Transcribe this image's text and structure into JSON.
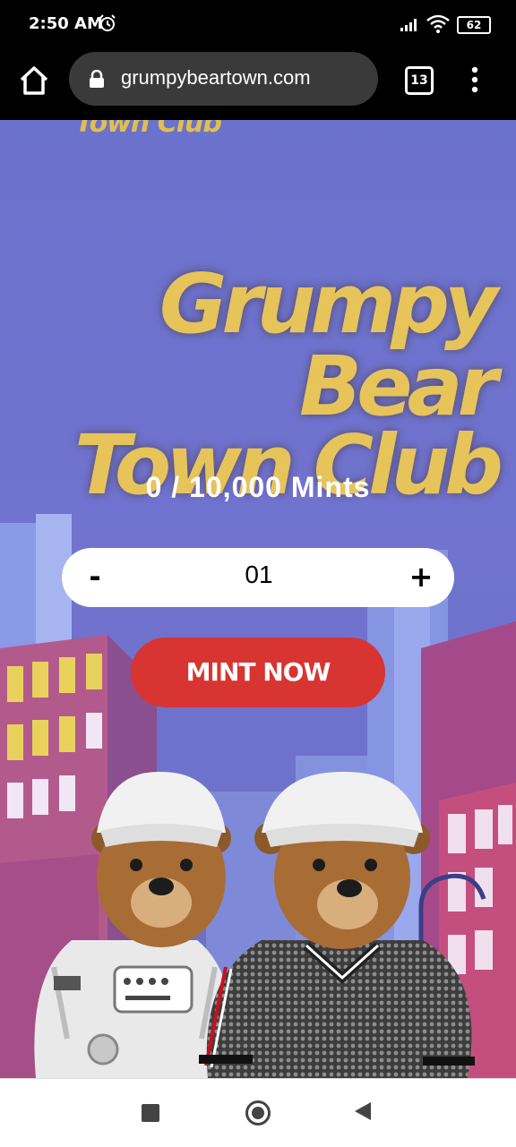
{
  "status_bar": {
    "time": "2:50 AM",
    "battery": "62"
  },
  "browser": {
    "url": "grumpybeartown.com",
    "tab_count": "13"
  },
  "page": {
    "top_logo_fragment": "Town Club",
    "logo_line1": "Grumpy Bear",
    "logo_line2": "Town Club",
    "mint_count": "0 / 10,000 Mints",
    "stepper": {
      "minus": "-",
      "quantity": "01",
      "plus": "+"
    },
    "mint_button": "MINT NOW"
  },
  "colors": {
    "background": "#6b72cc",
    "logo_gold": "#e6c45a",
    "mint_button": "#d83431"
  },
  "icons": [
    "home-icon",
    "lock-icon",
    "tabs-icon",
    "menu-icon",
    "alarm-icon",
    "signal-icon",
    "wifi-icon",
    "battery-icon"
  ]
}
